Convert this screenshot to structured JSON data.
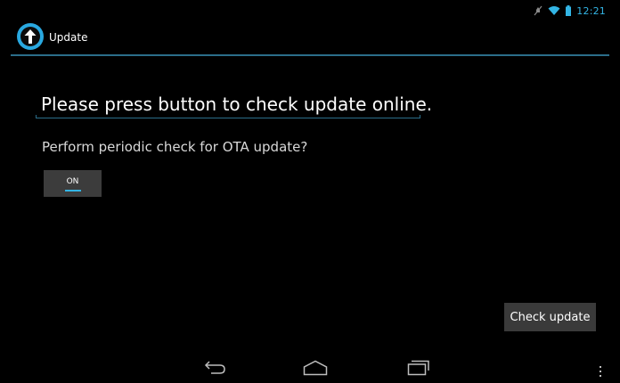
{
  "status_bar": {
    "time": "12:21",
    "icons": [
      "silent-icon",
      "wifi-icon",
      "battery-icon"
    ]
  },
  "action_bar": {
    "title": "Update",
    "icon": "update-arrow-icon"
  },
  "content": {
    "headline": "Please press button to check update online.",
    "question": "Perform periodic check for OTA update?",
    "toggle": {
      "label": "ON",
      "state": true
    },
    "check_button": "Check update"
  },
  "nav_bar": {
    "icons": [
      "back-icon",
      "home-icon",
      "recent-apps-icon",
      "menu-icon"
    ]
  },
  "colors": {
    "accent": "#33b5e5",
    "background": "#000000",
    "button": "#3a3a3a"
  }
}
